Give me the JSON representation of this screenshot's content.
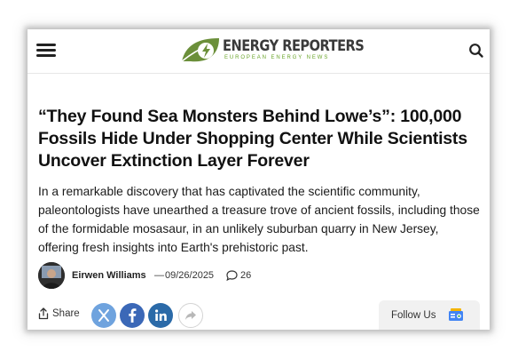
{
  "header": {
    "logo_title": "ENERGY REPORTERS",
    "logo_subtitle": "EUROPEAN ENERGY NEWS",
    "menu_icon": "hamburger-menu-icon",
    "search_icon": "search-icon"
  },
  "article": {
    "title": "“They Found Sea Monsters Behind Lowe’s”: 100,000 Fossils Hide Under Shopping Center While Scientists Uncover Extinction Layer Forever",
    "dek": "In a remarkable discovery that has captivated the scientific community, paleontologists have unearthed a treasure trove of ancient fossils, including those of the formidable mosasaur, in an unlikely suburban quarry in New Jersey, offering fresh insights into Earth's prehistoric past."
  },
  "byline": {
    "author": "Eirwen Williams",
    "separator": "—",
    "date": "09/26/2025",
    "comment_count": "26"
  },
  "actions": {
    "share_label": "Share",
    "follow_label": "Follow Us",
    "share_buttons": [
      "x-icon",
      "facebook-icon",
      "linkedin-icon",
      "forward-arrow-icon"
    ]
  },
  "colors": {
    "logo_green": "#6aa52a",
    "x_blue": "#6fa3de",
    "facebook_blue": "#3b68b7",
    "linkedin_blue": "#2b6aa8"
  }
}
